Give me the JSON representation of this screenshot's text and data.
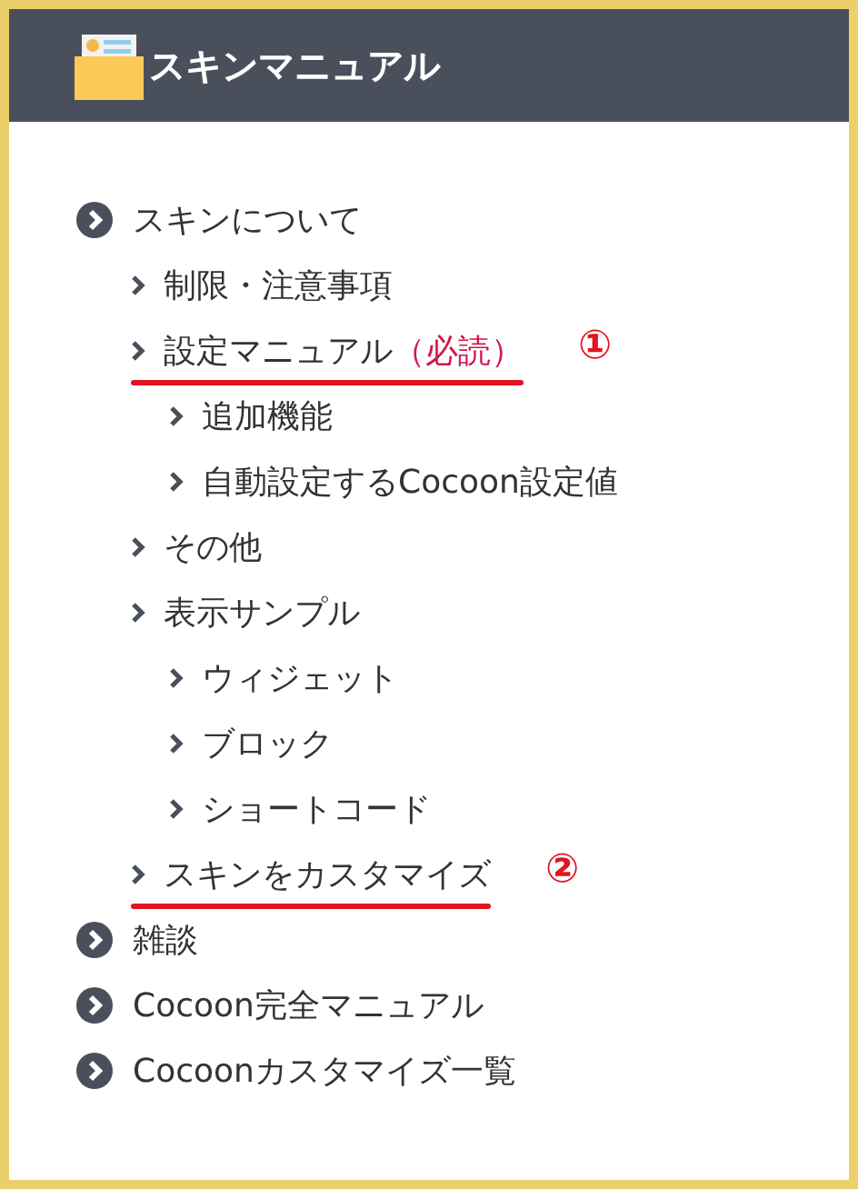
{
  "header": {
    "title": "スキンマニュアル"
  },
  "menu": [
    {
      "label": "スキンについて",
      "children": [
        {
          "label": "制限・注意事項"
        },
        {
          "label": "設定マニュアル",
          "note": "（必読）",
          "annotation": "①",
          "children": [
            {
              "label": "追加機能"
            },
            {
              "label": "自動設定するCocoon設定値"
            }
          ]
        },
        {
          "label": "その他"
        },
        {
          "label": "表示サンプル",
          "children": [
            {
              "label": "ウィジェット"
            },
            {
              "label": "ブロック"
            },
            {
              "label": "ショートコード"
            }
          ]
        },
        {
          "label": "スキンをカスタマイズ",
          "annotation": "②"
        }
      ]
    },
    {
      "label": "雑談"
    },
    {
      "label": "Cocoon完全マニュアル"
    },
    {
      "label": "Cocoonカスタマイズ一覧"
    }
  ]
}
